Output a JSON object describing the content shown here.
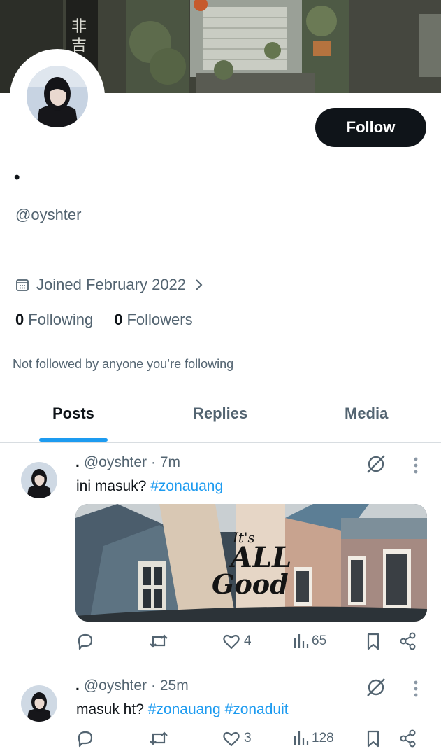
{
  "profile": {
    "display_name": "•",
    "handle": "@oyshter",
    "joined": "Joined February 2022",
    "following_count": "0",
    "following_label": "Following",
    "followers_count": "0",
    "followers_label": "Followers",
    "not_followed": "Not followed by anyone you’re following",
    "follow_label": "Follow"
  },
  "tabs": [
    {
      "label": "Posts",
      "active": true
    },
    {
      "label": "Replies",
      "active": false
    },
    {
      "label": "Media",
      "active": false
    }
  ],
  "posts": [
    {
      "name": ".",
      "handle": "@oyshter",
      "time": "· 7m",
      "text": "ini masuk?",
      "tags": [
        "#zonauang"
      ],
      "likes": "4",
      "views": "65"
    },
    {
      "name": ".",
      "handle": "@oyshter",
      "time": "· 25m",
      "text": "masuk ht?",
      "tags": [
        "#zonauang",
        "#zonaduit"
      ],
      "likes": "3",
      "views": "128"
    }
  ],
  "media_overlay_text": {
    "line1": "It's",
    "line2": "ALL",
    "line3": "Good"
  },
  "colors": {
    "accent": "#1d9bf0",
    "text_primary": "#0f1419",
    "text_secondary": "#536471",
    "button_bg": "#0f1419"
  },
  "icons": [
    "calendar-icon",
    "chevron-right-icon",
    "grok-icon",
    "more-icon",
    "reply-icon",
    "repost-icon",
    "like-icon",
    "views-icon",
    "bookmark-icon",
    "share-icon"
  ]
}
